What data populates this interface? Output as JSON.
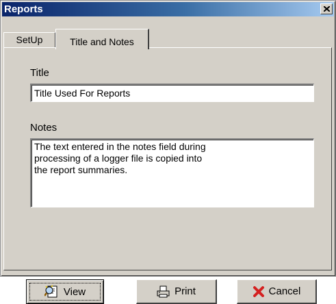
{
  "window": {
    "title": "Reports"
  },
  "tabs": [
    {
      "label": "SetUp",
      "active": false
    },
    {
      "label": "Title and Notes",
      "active": true
    }
  ],
  "title_section": {
    "label": "Title",
    "value": "Title Used For Reports"
  },
  "notes_section": {
    "label": "Notes",
    "value": "The text entered in the notes field during\nprocessing of a logger file is copied into\nthe report summaries."
  },
  "buttons": {
    "view": {
      "label": "View",
      "icon": "view-report-icon"
    },
    "print": {
      "label": "Print",
      "icon": "printer-icon"
    },
    "cancel": {
      "label": "Cancel",
      "icon": "red-x-icon"
    }
  },
  "colors": {
    "titlebar_start": "#0a246a",
    "titlebar_end": "#a6caf0",
    "face": "#d4d0c8",
    "cancel_icon": "#d42020"
  }
}
